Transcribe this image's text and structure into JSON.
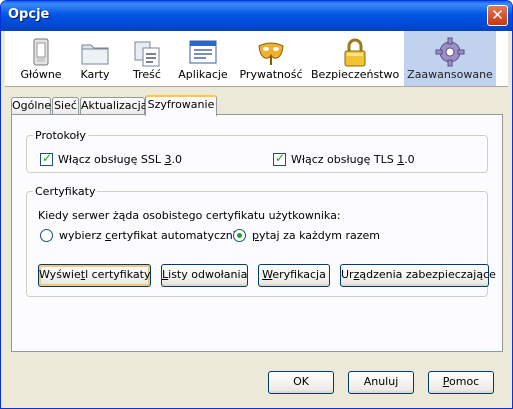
{
  "window": {
    "title": "Opcje",
    "close_symbol": "✕"
  },
  "toolbar": {
    "items": [
      {
        "label": "Główne",
        "icon": "general-icon"
      },
      {
        "label": "Karty",
        "icon": "tabs-folder-icon"
      },
      {
        "label": "Treść",
        "icon": "content-icon"
      },
      {
        "label": "Aplikacje",
        "icon": "applications-icon"
      },
      {
        "label": "Prywatność",
        "icon": "privacy-mask-icon"
      },
      {
        "label": "Bezpieczeństwo",
        "icon": "padlock-icon"
      },
      {
        "label": "Zaawansowane",
        "icon": "gear-icon",
        "selected": true
      }
    ]
  },
  "subtabs": [
    {
      "label": "Ogólne"
    },
    {
      "label": "Sieć"
    },
    {
      "label": "Aktualizacja"
    },
    {
      "label": "Szyfrowanie",
      "active": true
    }
  ],
  "protocols": {
    "legend": "Protokoły",
    "ssl": {
      "pre": "Włącz obsługę SSL ",
      "acc": "3",
      "post": ".0",
      "checked": true
    },
    "tls": {
      "pre": "Włącz obsługę TLS ",
      "acc": "1",
      "post": ".0",
      "checked": true
    }
  },
  "certificates": {
    "legend": "Certyfikaty",
    "question": "Kiedy serwer żąda osobistego certyfikatu użytkownika:",
    "auto": {
      "pre": "wybierz ",
      "acc": "c",
      "post": "ertyfikat automatycznie",
      "selected": false
    },
    "ask": {
      "pre": "",
      "acc": "p",
      "post": "ytaj za każdym razem",
      "selected": true
    },
    "buttons": {
      "view": {
        "pre": "Wyświe",
        "acc": "t",
        "post": "l certyfikaty"
      },
      "crl": {
        "pre": "",
        "acc": "L",
        "post": "isty odwołania"
      },
      "verify": {
        "pre": "",
        "acc": "W",
        "post": "eryfikacja"
      },
      "devices": {
        "pre": "Ur",
        "acc": "z",
        "post": "ądzenia zabezpieczające"
      }
    }
  },
  "dialog_buttons": {
    "ok": "OK",
    "cancel": "Anuluj",
    "help": {
      "pre": "",
      "acc": "P",
      "post": "omoc"
    }
  }
}
